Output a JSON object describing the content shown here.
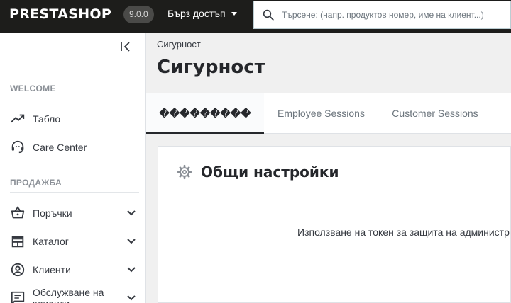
{
  "header": {
    "logo": "PRESTASHOP",
    "version": "9.0.0",
    "quick_access": "Бърз достъп",
    "search_placeholder": "Търсене: (напр. продуктов номер, име на клиент...)"
  },
  "sidebar": {
    "sections": [
      {
        "title": "WELCOME",
        "items": [
          {
            "label": "Табло",
            "icon": "trending-up-icon"
          },
          {
            "label": "Care Center",
            "icon": "support-agent-icon"
          }
        ]
      },
      {
        "title": "ПРОДАЖБА",
        "items": [
          {
            "label": "Поръчки",
            "icon": "shopping-basket-icon"
          },
          {
            "label": "Каталог",
            "icon": "store-icon"
          },
          {
            "label": "Клиенти",
            "icon": "account-circle-icon"
          },
          {
            "label": "Обслужване на клиенти",
            "icon": "chat-icon"
          }
        ]
      }
    ]
  },
  "main": {
    "breadcrumb": "Сигурност",
    "title": "Сигурност",
    "tabs": [
      {
        "label": "���������",
        "active": true
      },
      {
        "label": "Employee Sessions",
        "active": false
      },
      {
        "label": "Customer Sessions",
        "active": false
      }
    ],
    "card": {
      "title": "Общи настройки",
      "option_label": "Използване на токен за защита на администр"
    }
  },
  "colors": {
    "header_bg": "#1d1d1b",
    "accent": "#25272b"
  }
}
